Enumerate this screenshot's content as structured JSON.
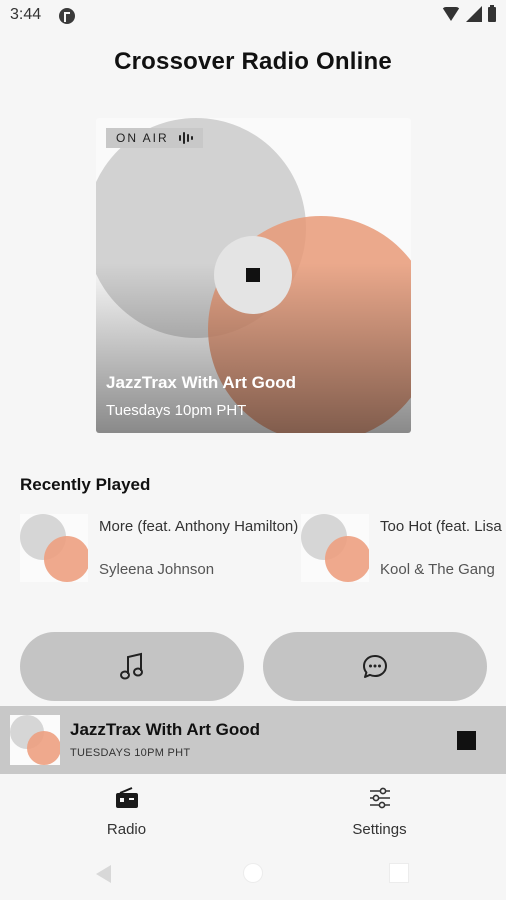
{
  "status_bar": {
    "time": "3:44",
    "icons": [
      "app-notification-icon",
      "wifi-icon",
      "signal-icon",
      "battery-icon"
    ]
  },
  "header": {
    "title": "Crossover Radio Online"
  },
  "now_playing_card": {
    "badge_label": "ON AIR",
    "badge_icon": "audio-bars-icon",
    "show_title": "JazzTrax With Art Good",
    "schedule": "Tuesdays 10pm PHT",
    "control_icon": "stop-icon",
    "colors": {
      "circle_gray": "#d0d0d0",
      "circle_orange": "#e79a78"
    }
  },
  "recently_played": {
    "title": "Recently Played",
    "items": [
      {
        "title": "More (feat. Anthony Hamilton)",
        "artist": "Syleena Johnson"
      },
      {
        "title": "Too Hot (feat. Lisa Stansfield)",
        "artist": "Kool & The Gang"
      }
    ]
  },
  "actions": {
    "left_icon": "music-note-icon",
    "right_icon": "chat-bubble-icon"
  },
  "mini_player": {
    "title": "JazzTrax With Art Good",
    "subtitle": "TUESDAYS 10PM PHT",
    "control_icon": "stop-icon"
  },
  "bottom_nav": {
    "items": [
      {
        "label": "Radio",
        "icon": "radio-icon",
        "active": true
      },
      {
        "label": "Settings",
        "icon": "sliders-icon",
        "active": false
      }
    ]
  },
  "system_nav": {
    "buttons": [
      "back-icon",
      "home-icon",
      "recents-icon"
    ]
  }
}
